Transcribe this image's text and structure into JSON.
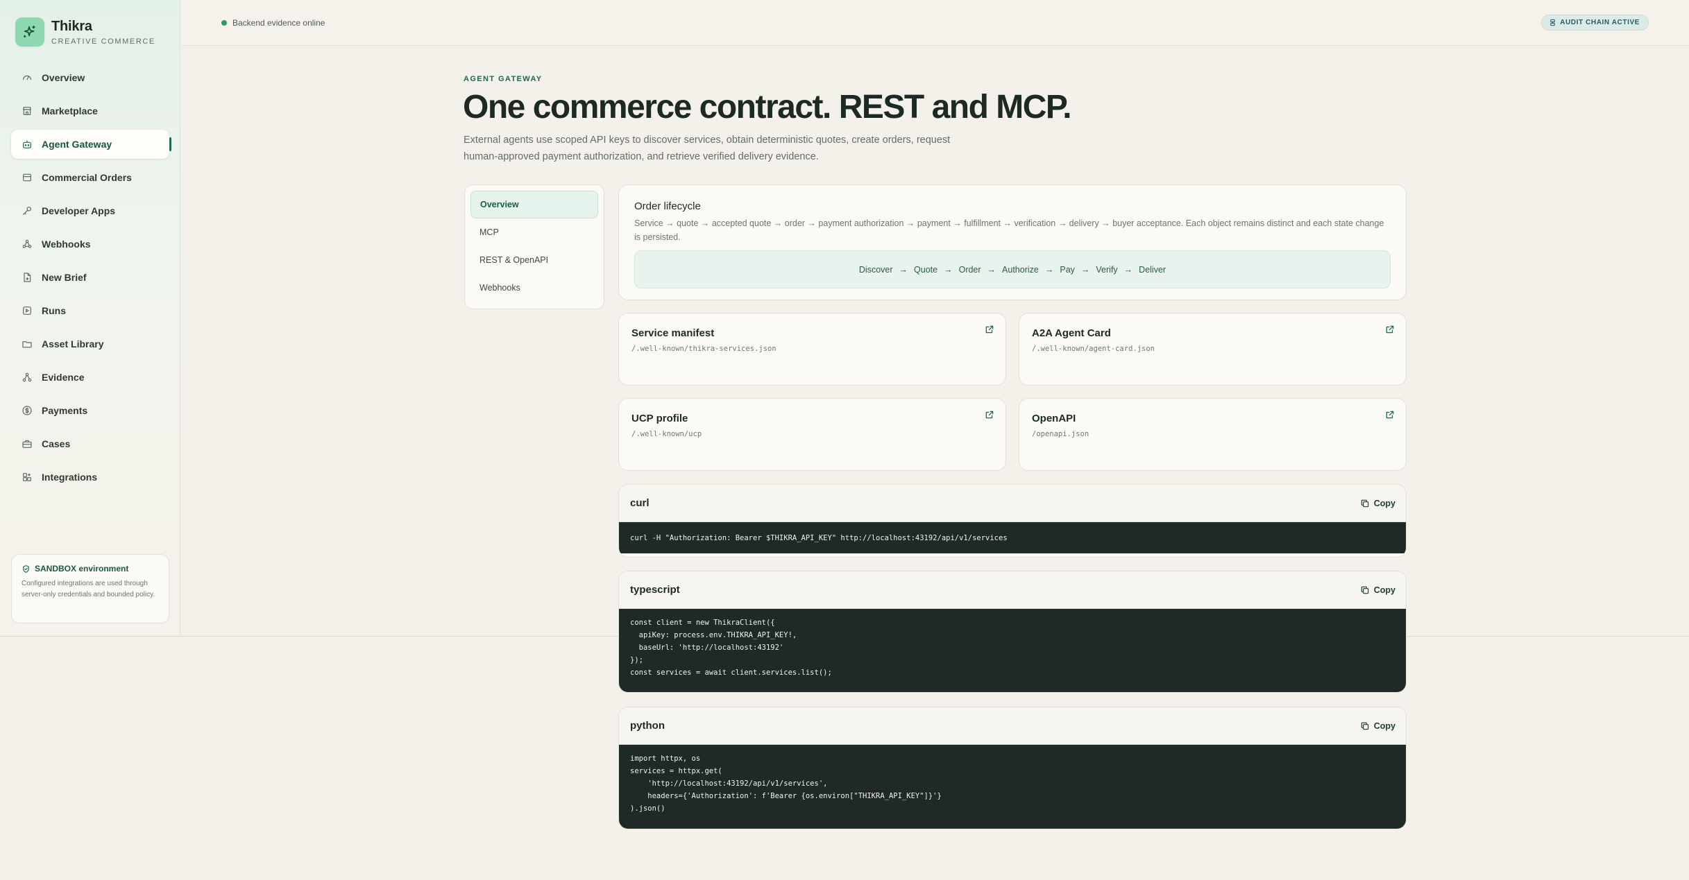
{
  "brand": {
    "name": "Thikra",
    "subtitle": "CREATIVE COMMERCE"
  },
  "sidebar": {
    "items": [
      {
        "label": "Overview",
        "icon": "gauge-icon"
      },
      {
        "label": "Marketplace",
        "icon": "storefront-icon"
      },
      {
        "label": "Agent Gateway",
        "icon": "bot-icon",
        "active": true
      },
      {
        "label": "Commercial Orders",
        "icon": "receipt-icon"
      },
      {
        "label": "Developer Apps",
        "icon": "key-icon"
      },
      {
        "label": "Webhooks",
        "icon": "webhook-icon"
      },
      {
        "label": "New Brief",
        "icon": "file-plus-icon"
      },
      {
        "label": "Runs",
        "icon": "play-square-icon"
      },
      {
        "label": "Asset Library",
        "icon": "folder-icon"
      },
      {
        "label": "Evidence",
        "icon": "network-icon"
      },
      {
        "label": "Payments",
        "icon": "dollar-circle-icon"
      },
      {
        "label": "Cases",
        "icon": "briefcase-icon"
      },
      {
        "label": "Integrations",
        "icon": "puzzle-icon"
      }
    ],
    "sandbox": {
      "title": "SANDBOX environment",
      "body": "Configured integrations are used through server-only credentials and bounded policy."
    }
  },
  "topbar": {
    "status": "Backend evidence online",
    "audit": "AUDIT CHAIN ACTIVE"
  },
  "page": {
    "eyebrow": "AGENT GATEWAY",
    "title": "One commerce contract. REST and MCP.",
    "lead": "External agents use scoped API keys to discover services, obtain deterministic quotes, create orders, request human-approved payment authorization, and retrieve verified delivery evidence."
  },
  "tabs": [
    "Overview",
    "MCP",
    "REST & OpenAPI",
    "Webhooks"
  ],
  "lifecycle": {
    "title": "Order lifecycle",
    "description": "Service → quote → accepted quote → order → payment authorization → payment → fulfillment → verification → delivery → buyer acceptance. Each object remains distinct and each state change is persisted.",
    "steps": [
      "Discover",
      "Quote",
      "Order",
      "Authorize",
      "Pay",
      "Verify",
      "Deliver"
    ]
  },
  "resources": [
    {
      "title": "Service manifest",
      "path": "/.well-known/thikra-services.json"
    },
    {
      "title": "A2A Agent Card",
      "path": "/.well-known/agent-card.json"
    },
    {
      "title": "UCP profile",
      "path": "/.well-known/ucp"
    },
    {
      "title": "OpenAPI",
      "path": "/openapi.json"
    }
  ],
  "code": {
    "copy_label": "Copy",
    "snippets": [
      {
        "lang": "curl",
        "code": "curl -H \"Authorization: Bearer $THIKRA_API_KEY\" http://localhost:43192/api/v1/services"
      },
      {
        "lang": "typescript",
        "code": "const client = new ThikraClient({\n  apiKey: process.env.THIKRA_API_KEY!,\n  baseUrl: 'http://localhost:43192'\n});\nconst services = await client.services.list();"
      },
      {
        "lang": "python",
        "code": "import httpx, os\nservices = httpx.get(\n    'http://localhost:43192/api/v1/services',\n    headers={'Authorization': f'Bearer {os.environ[\"THIKRA_API_KEY\"]}'}\n).json()"
      }
    ]
  },
  "colors": {
    "accent": "#1d6b49",
    "brand_tile": "#8ed8b1",
    "code_bg": "#1f2a26",
    "status_dot": "#2f9a64"
  }
}
